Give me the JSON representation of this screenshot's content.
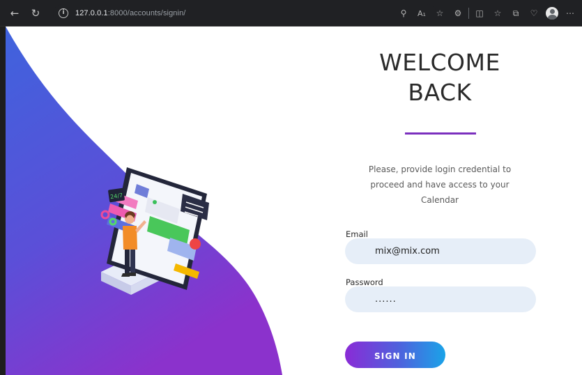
{
  "browser": {
    "url_host": "127.0.0.1",
    "url_rest": ":8000/accounts/signin/",
    "icons": [
      "back-arrow-icon",
      "reload-icon",
      "info-icon",
      "key-icon",
      "read-aloud-icon",
      "favorite-star-icon",
      "extension-icon",
      "split-screen-icon",
      "favorites-icon",
      "collections-icon",
      "browser-essentials-icon",
      "profile-icon",
      "more-icon"
    ]
  },
  "left_panel": {
    "illustration": "person-with-customer-support-tablet",
    "badge_text": "24/7",
    "gradient": [
      "#3f63dd",
      "#6a3fd3",
      "#8b32cc"
    ]
  },
  "signin_form": {
    "title_line1": "WELCOME",
    "title_line2": "BACK",
    "accent_color": "#7b2fbe",
    "intro": "Please, provide login credential to proceed and have access to your Calendar",
    "email_label": "Email",
    "email_value": "mix@mix.com",
    "password_label": "Password",
    "password_value": "......",
    "submit_label": "SIGN IN"
  }
}
